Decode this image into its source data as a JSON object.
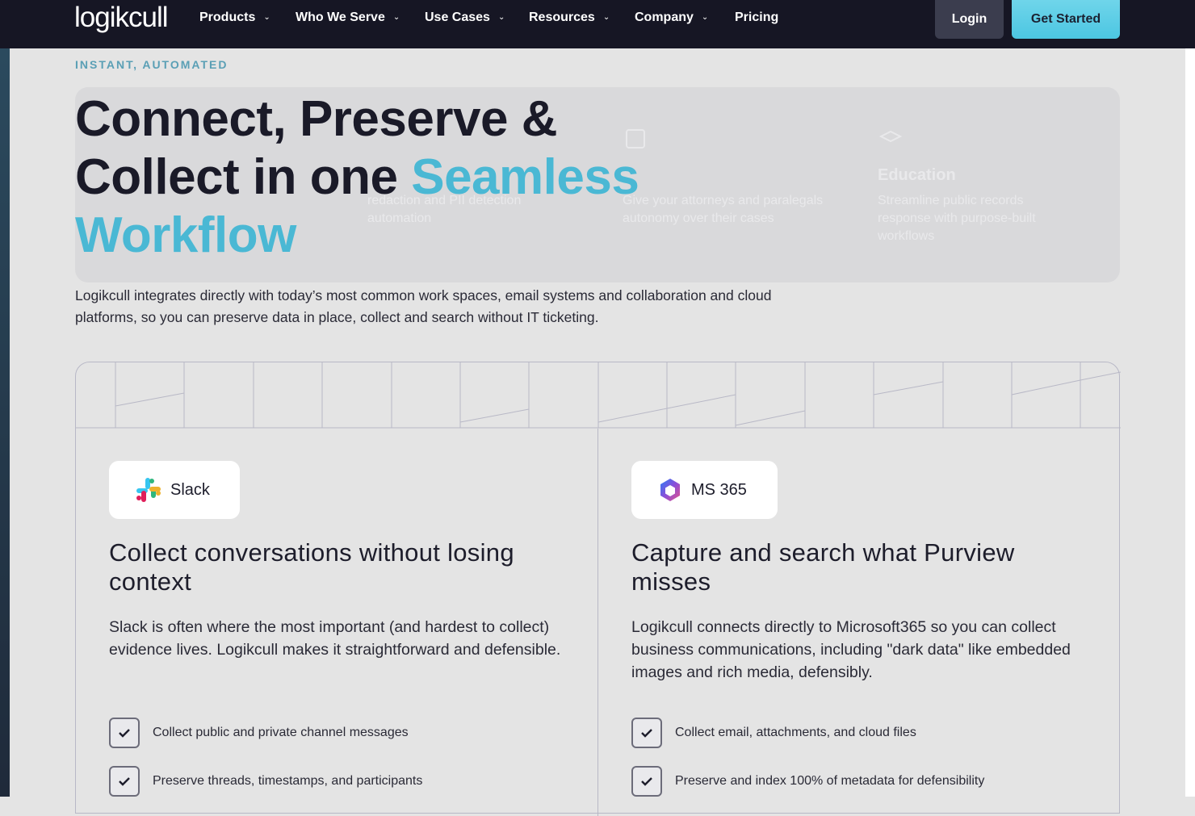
{
  "brand": {
    "logo_text": "logikcull"
  },
  "nav": {
    "items": [
      {
        "label": "Products",
        "has_dropdown": true
      },
      {
        "label": "Who We Serve",
        "has_dropdown": true
      },
      {
        "label": "Use Cases",
        "has_dropdown": true
      },
      {
        "label": "Resources",
        "has_dropdown": true
      },
      {
        "label": "Company",
        "has_dropdown": true
      },
      {
        "label": "Pricing",
        "has_dropdown": false
      }
    ],
    "login_label": "Login",
    "cta_label": "Get Started"
  },
  "hero": {
    "eyebrow": "INSTANT, AUTOMATED",
    "title_line1": "Connect, Preserve &",
    "title_line2_plain": "Collect in one ",
    "title_line2_accent": "Seamless",
    "title_line3_accent": "Workflow",
    "description": "Logikcull integrates directly with today’s most common work spaces, email systems and collaboration and cloud platforms, so you can preserve data in place, collect and search without IT ticketing."
  },
  "ghost_panel": {
    "col2_text": "redaction and PII detection automation",
    "col3_text": "Give your attorneys and paralegals autonomy over their cases",
    "col4_heading": "Education",
    "col4_text": "Streamline public records response with purpose-built workflows"
  },
  "integrations": [
    {
      "pill_label": "Slack",
      "icon": "slack-icon",
      "title": "Collect conversations without losing context",
      "description": "Slack is often where the most important (and hardest to collect) evidence lives. Logikcull makes it straightforward and defensible.",
      "checks": [
        "Collect public and private channel messages",
        "Preserve threads, timestamps, and participants"
      ]
    },
    {
      "pill_label": "MS 365",
      "icon": "ms365-icon",
      "title": "Capture and search what Purview misses",
      "description": "Logikcull connects directly to Microsoft365 so you can collect business communications, including \"dark data\" like embedded images and rich media, defensibly.",
      "checks": [
        "Collect email, attachments, and cloud files",
        "Preserve and index 100% of metadata for defensibility"
      ]
    }
  ],
  "colors": {
    "nav_bg": "#161624",
    "accent": "#4ab8d4",
    "cta": "#5ccde6",
    "page_bg": "#e4e4e4"
  }
}
